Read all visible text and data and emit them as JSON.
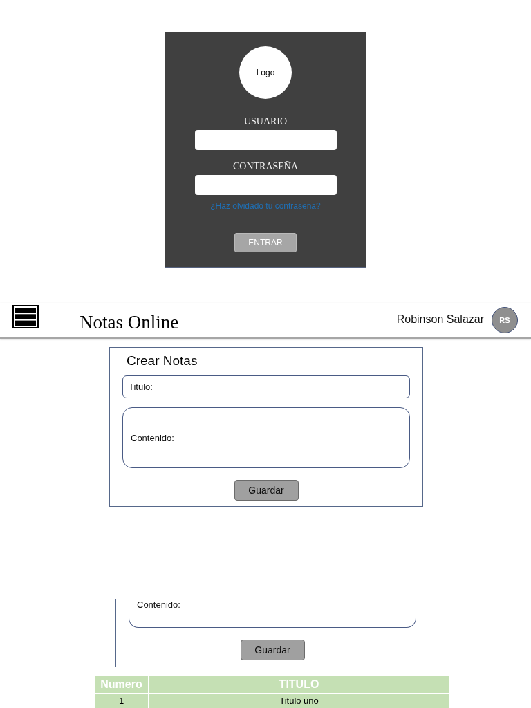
{
  "login": {
    "logo": "Logo",
    "fields": [
      {
        "label": "USUARIO"
      },
      {
        "label": "CONTRASEÑA"
      }
    ],
    "forgot_link": "¿Haz olvidado tu contraseña?",
    "submit_button": "ENTRAR"
  },
  "header": {
    "app_title": "Notas Online",
    "user_name": "Robinson Salazar",
    "avatar_initials": "RS"
  },
  "note_form": {
    "title": "Crear Notas",
    "title_field": {
      "placeholder": "Titulo:"
    },
    "content_field": {
      "placeholder": "Contenido:"
    },
    "save_button": "Guardar"
  },
  "note_form_partial": {
    "content_field": {
      "placeholder": "Contenido:"
    },
    "save_button": "Guardar"
  },
  "notes_table": {
    "columns": [
      "Numero",
      "TITULO"
    ],
    "rows": [
      [
        "1",
        "Titulo uno"
      ]
    ]
  }
}
